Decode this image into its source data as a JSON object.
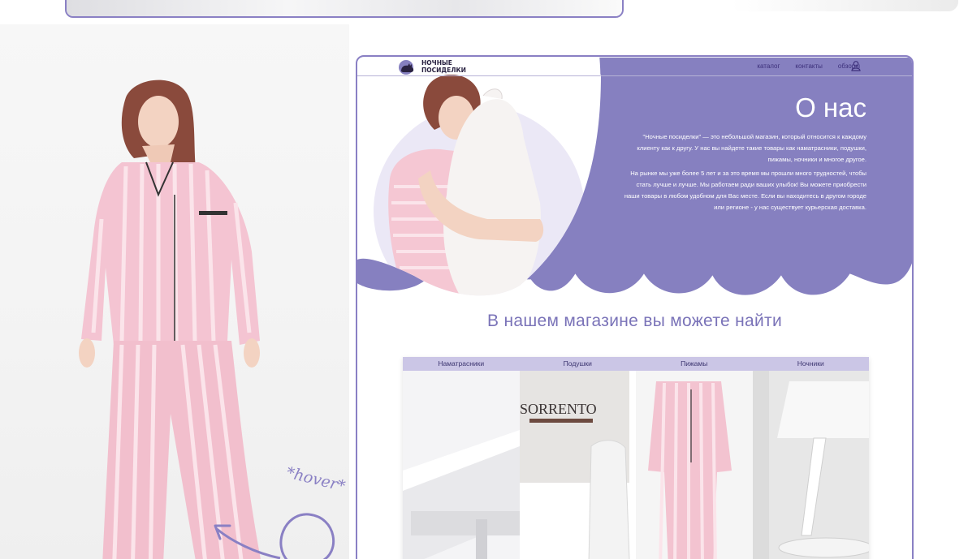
{
  "annotation": {
    "hover_note": "*hover*"
  },
  "header": {
    "logo_line1": "Ночные",
    "logo_line2": "посиделки",
    "nav": [
      "каталог",
      "контакты",
      "обзоры"
    ]
  },
  "about": {
    "title": "О нас",
    "paragraph1": "\"Ночные посиделки\" — это небольшой магазин, который относится к каждому клиенту как к другу. У нас вы найдете такие товары как наматрасники, подушки, пижамы, ночники и многое другое.",
    "paragraph2": "На рынке мы уже более 5 лет и за это время мы прошли много трудностей, чтобы стать лучше и лучше. Мы работаем ради ваших улыбок! Вы можете приобрести наши товары в любом удобном для Вас месте. Если вы находитесь в другом городе или регионе - у нас существует курьерская доставка."
  },
  "find": {
    "title": "В нашем магазине вы можете найти",
    "categories": [
      {
        "label": "Наматрасники"
      },
      {
        "label": "Подушки",
        "product_text": "SORRENTO"
      },
      {
        "label": "Пижамы"
      },
      {
        "label": "Ночники"
      }
    ]
  },
  "colors": {
    "accent": "#8a80c4",
    "hero": "#8680c0",
    "pink": "#f2c1cf"
  }
}
